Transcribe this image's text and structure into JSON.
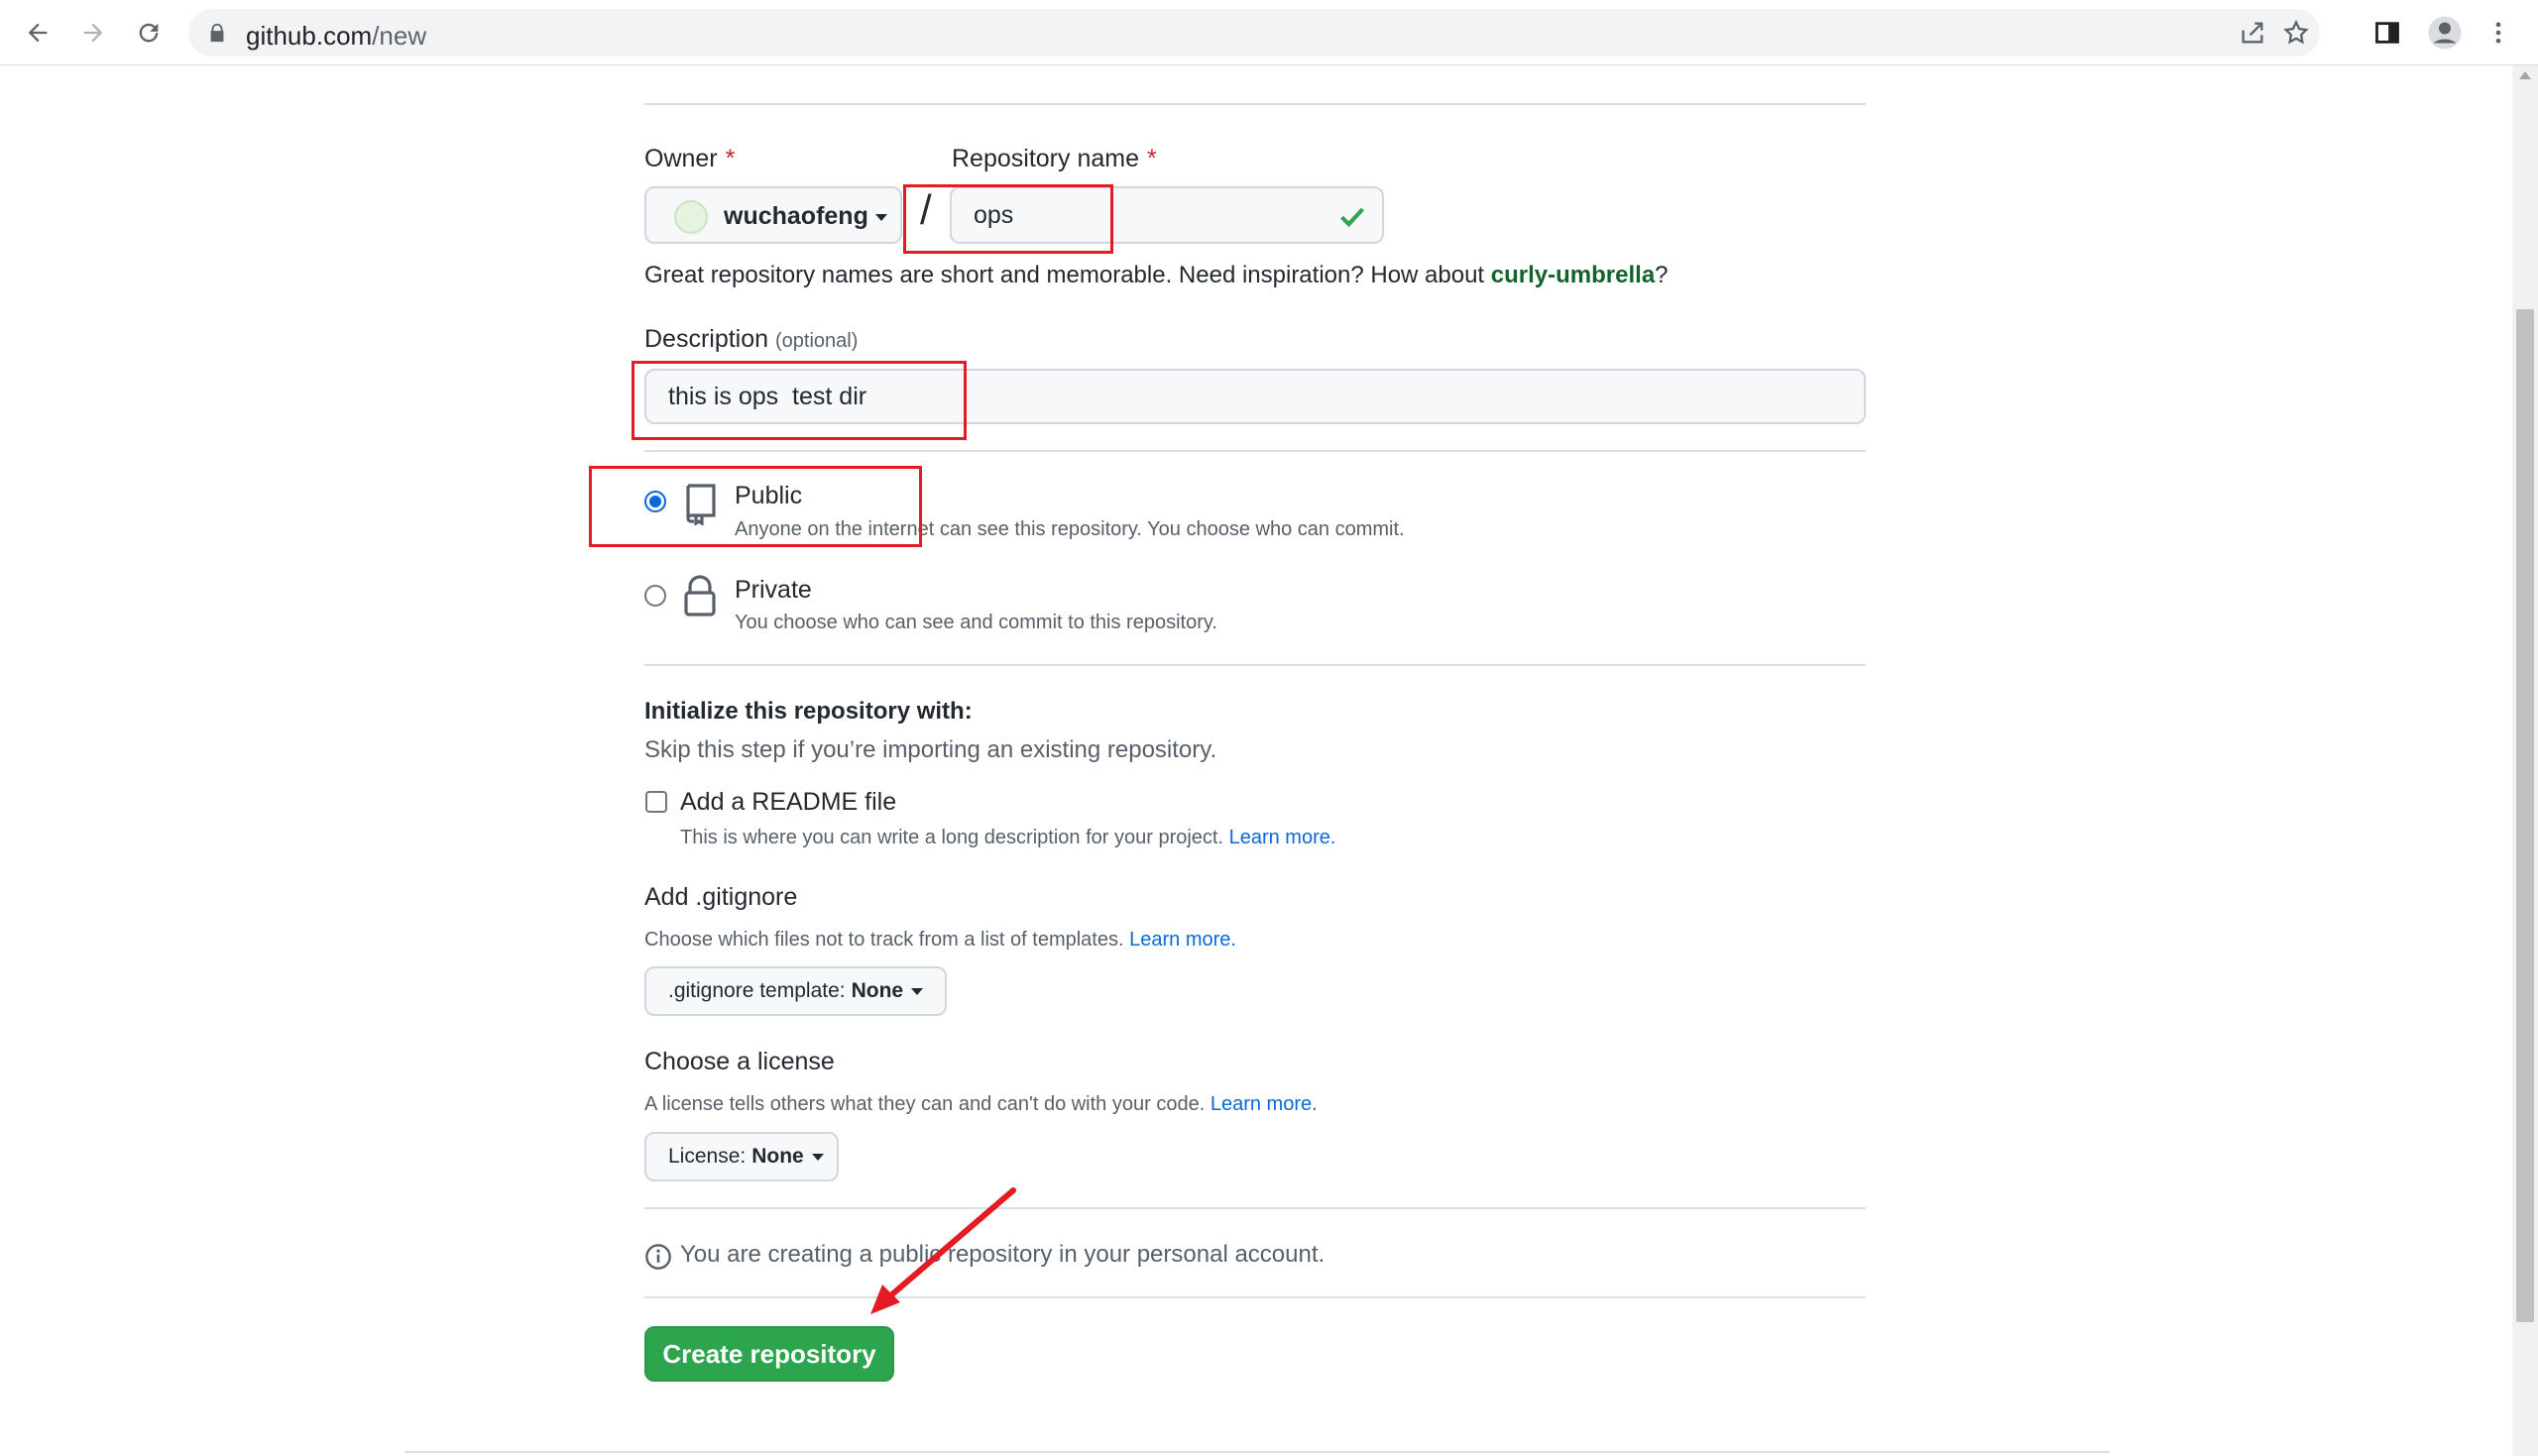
{
  "browser": {
    "url_host": "github.com",
    "url_path": "/new"
  },
  "owner": {
    "label": "Owner",
    "required_mark": "*",
    "value": "wuchaofeng"
  },
  "repo_name": {
    "label": "Repository name",
    "required_mark": "*",
    "slash": "/",
    "value": "ops"
  },
  "hint": {
    "text": "Great repository names are short and memorable. Need inspiration? How about ",
    "suggestion": "curly-umbrella",
    "end": "?"
  },
  "description": {
    "label": "Description",
    "optional": "(optional)",
    "value": "this is ops  test dir"
  },
  "visibility": {
    "public": {
      "title": "Public",
      "desc": "Anyone on the internet can see this repository. You choose who can commit.",
      "checked": true
    },
    "private": {
      "title": "Private",
      "desc": "You choose who can see and commit to this repository.",
      "checked": false
    }
  },
  "init": {
    "heading": "Initialize this repository with:",
    "sub": "Skip this step if you’re importing an existing repository.",
    "readme_label": "Add a README file",
    "readme_desc": "This is where you can write a long description for your project.",
    "learn_more": "Learn more."
  },
  "gitignore": {
    "heading": "Add .gitignore",
    "desc": "Choose which files not to track from a list of templates.",
    "learn_more": "Learn more.",
    "button_prefix": ".gitignore template:",
    "button_value": "None"
  },
  "license": {
    "heading": "Choose a license",
    "desc": "A license tells others what they can and can't do with your code.",
    "learn_more": "Learn more.",
    "button_prefix": "License:",
    "button_value": "None"
  },
  "notice": {
    "text": "You are creating a public repository in your personal account."
  },
  "submit": {
    "label": "Create repository"
  },
  "colors": {
    "accent_blue": "#0969da",
    "success_green": "#2da44e",
    "suggestion_green": "#116329",
    "annotation_red": "#e31b23"
  }
}
